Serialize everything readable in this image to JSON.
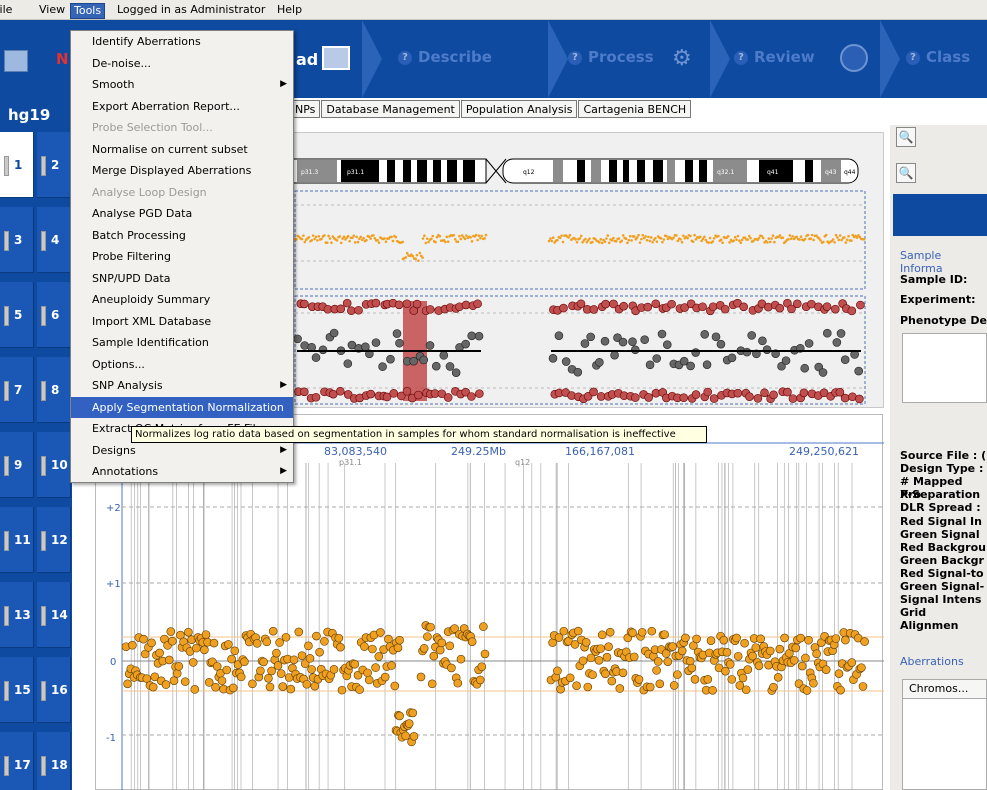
{
  "menubar": [
    "File",
    "View",
    "Tools",
    "Logged in as Administrator",
    "Help"
  ],
  "workflow": {
    "brand_fragment": "N",
    "load_fragment": "ad",
    "buttons": [
      "Describe",
      "Process",
      "Review",
      "Class"
    ],
    "help_glyph": "?"
  },
  "genome": {
    "build": "hg19",
    "chromosomes": [
      "1",
      "2",
      "3",
      "4",
      "5",
      "6",
      "7",
      "8",
      "9",
      "10",
      "11",
      "12",
      "13",
      "14",
      "15",
      "16",
      "17",
      "18"
    ],
    "selected": "1"
  },
  "tabs": [
    "NPs",
    "Database Management",
    "Population Analysis",
    "Cartagenia BENCH"
  ],
  "ideogram": {
    "bands": [
      "p31.3",
      "p31.1",
      "q12",
      "q32.1",
      "q41",
      "q43",
      "q44"
    ]
  },
  "bottom_plot": {
    "top_ticks": [
      "83,083,540",
      "249.25Mb",
      "166,167,081",
      "249,250,621"
    ],
    "sub_ticks": [
      "p31.1",
      "q12"
    ],
    "y_labels": [
      "+2",
      "+1",
      "0",
      "-1"
    ]
  },
  "tools_menu": {
    "items": [
      {
        "label": "Identify Aberrations",
        "disabled": false,
        "submenu": false
      },
      {
        "label": "De-noise...",
        "disabled": false,
        "submenu": false
      },
      {
        "label": "Smooth",
        "disabled": false,
        "submenu": true
      },
      {
        "label": "Export Aberration Report...",
        "disabled": false,
        "submenu": false
      },
      {
        "label": "Probe Selection Tool...",
        "disabled": true,
        "submenu": false
      },
      {
        "label": "Normalise on current subset",
        "disabled": false,
        "submenu": false
      },
      {
        "label": "Merge Displayed Aberrations",
        "disabled": false,
        "submenu": false
      },
      {
        "label": "Analyse Loop Design",
        "disabled": true,
        "submenu": false
      },
      {
        "label": "Analyse PGD Data",
        "disabled": false,
        "submenu": false
      },
      {
        "label": "Batch Processing",
        "disabled": false,
        "submenu": false
      },
      {
        "label": "Probe Filtering",
        "disabled": false,
        "submenu": false
      },
      {
        "label": "SNP/UPD Data",
        "disabled": false,
        "submenu": false
      },
      {
        "label": "Aneuploidy Summary",
        "disabled": false,
        "submenu": false
      },
      {
        "label": "Import XML Database",
        "disabled": false,
        "submenu": false
      },
      {
        "label": "Sample Identification",
        "disabled": false,
        "submenu": false
      },
      {
        "label": "Options...",
        "disabled": false,
        "submenu": false
      },
      {
        "label": "SNP Analysis",
        "disabled": false,
        "submenu": true
      },
      {
        "label": "Apply Segmentation Normalization",
        "disabled": false,
        "submenu": false,
        "highlighted": true
      },
      {
        "label": "Extract QC Metrics from FE Files",
        "disabled": false,
        "submenu": false
      },
      {
        "label": "Designs",
        "disabled": false,
        "submenu": true
      },
      {
        "label": "Annotations",
        "disabled": false,
        "submenu": true
      }
    ]
  },
  "tooltip": "Normalizes log ratio data based on segmentation in samples for whom standard normalisation is ineffective",
  "right_panel": {
    "sample_info_title": "Sample Informa",
    "sample_fields": [
      "Sample ID:",
      "Experiment:",
      "Phenotype De"
    ],
    "source_fields": [
      "Source File : (",
      "Design Type :",
      "# Mapped Pro",
      "X-Separation",
      "DLR Spread :",
      "Red Signal In",
      "Green Signal",
      "Red Backgrou",
      "Green Backgr",
      "Red Signal-to",
      "Green Signal-",
      "Signal Intens",
      "Grid Alignmen"
    ],
    "aberrations_title": "Aberrations",
    "aberrations_column": "Chromos..."
  },
  "colors": {
    "app_blue": "#0d4aa0",
    "menu_highlight": "#3361c2",
    "probe_orange": "#f0a020",
    "snp_red": "#b03030"
  }
}
